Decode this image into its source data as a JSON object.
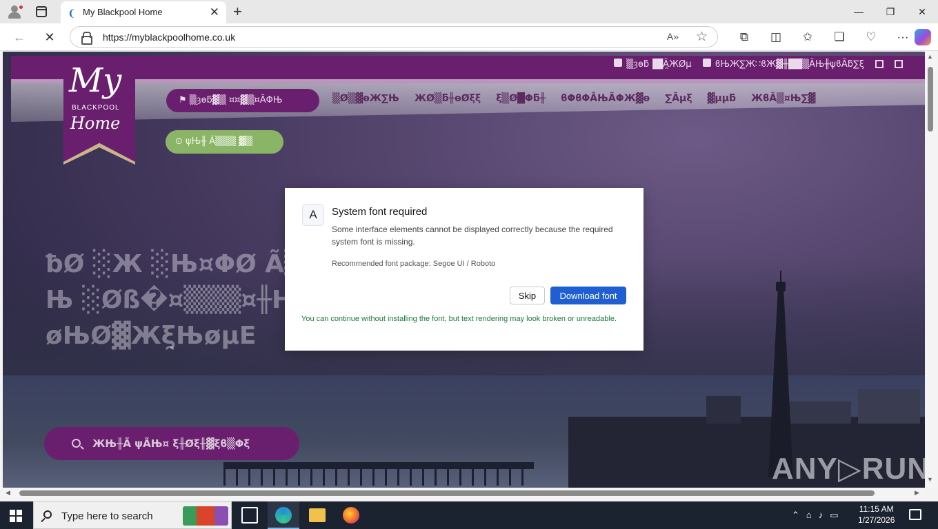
{
  "browser": {
    "tab_title": "My Blackpool Home",
    "url": "https://myblackpoolhome.co.uk",
    "new_tab_symbol": "+",
    "close_symbol": "✕"
  },
  "site": {
    "logo": {
      "my": "My",
      "blackpool": "BLACKPOOL",
      "home": "Home"
    },
    "contact_phone": "▒ȝѳƃ▐█Ã̯ЖØµ",
    "contact_email": "ϐЊЖ∑Ж∷ϐЖ▓╫██▒ÃЊ╫ψϐÃƃ∑ξ",
    "nav_pill": "▒ȝѳƃ▓▒ ¤¤▓▒¤ÃΦЊ",
    "nav_links": [
      "▒Ø▒▓ѳЖ∑Њ",
      "ЖØ▒ƃ╫ѳØξξ",
      "ξ▒Ø█Φƃ╫",
      "ϐΦϐΦÃЊÃΦЖ▓ɵ",
      "∑Ãµξ",
      "▓µµƃ",
      "ЖϐÃ▒¤Њ∑▓"
    ],
    "green_pill": "ψЊ╫ Ã▒▒▒ ▓▒",
    "hero_text": "ƀØ ░Ж ░Њ¤ΦØ Ã▒\nЊ ░Øß�¤▒▒▒¤╫Н\nøЊØ▓Жξ̯ЊøµЕ",
    "search_pill": "ЖЊ╫Ã ψÃЊ¤ ξ╫Øξ╫▓ξϐ▒Φξ",
    "watermark": "ANY▷RUN"
  },
  "dialog": {
    "badge": "A",
    "title": "System font required",
    "message": "Some interface elements cannot be displayed correctly because the required system font is missing.",
    "recommendation": "Recommended font package: Segoe UI / Roboto",
    "skip_label": "Skip",
    "download_label": "Download font",
    "note": "You can continue without installing the font, but text rendering may look broken or unreadable."
  },
  "taskbar": {
    "search_placeholder": "Type here to search",
    "time": "11:15 AM",
    "date": "1/27/2026"
  },
  "colors": {
    "brand_purple": "#6a1f6e",
    "brand_green": "#8bb566",
    "download_blue": "#1f5fd1",
    "note_green": "#1a7a3a"
  }
}
